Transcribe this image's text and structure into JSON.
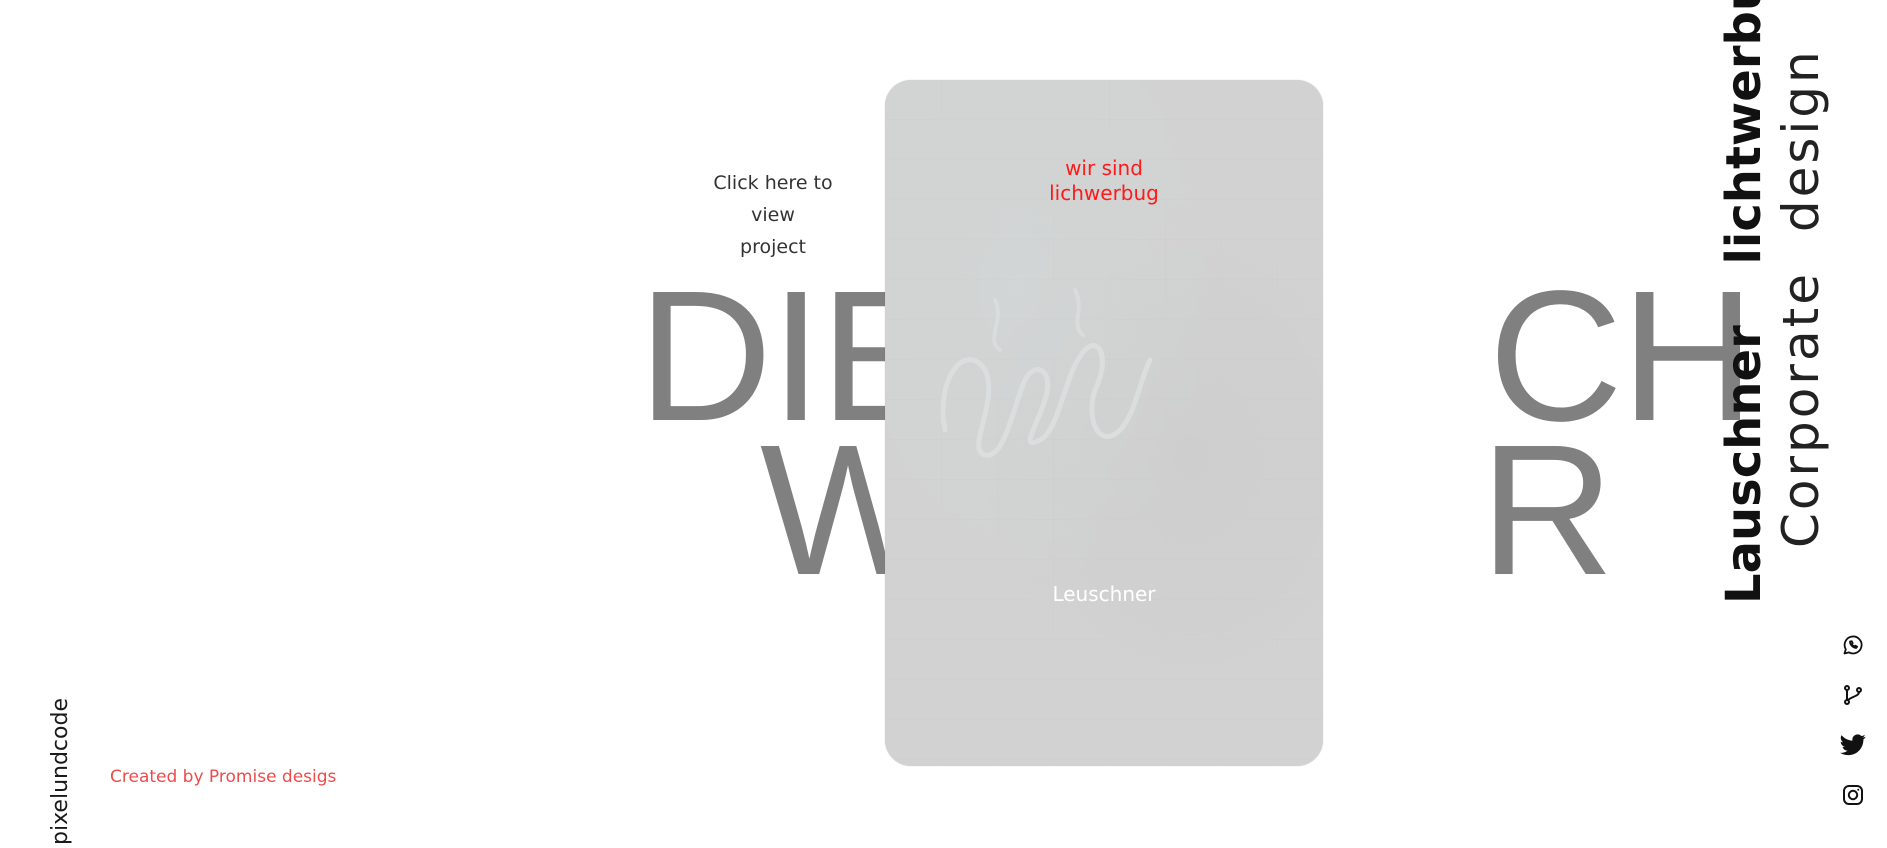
{
  "headline": {
    "line1": "DIE           CH",
    "line2": "W           R"
  },
  "card": {
    "tagline_line1": "wir sind",
    "tagline_line2": "lichwerbug",
    "name": "Leuschner",
    "tagline_color": "#ff1a1a"
  },
  "cta": {
    "line1": "Click here to view",
    "line2": "project"
  },
  "side_titles": {
    "title": "Lauschner lichtwerbung",
    "subtitle": "Corporate design"
  },
  "social": {
    "icons": [
      "whatsapp-icon",
      "git-branch-icon",
      "twitter-icon",
      "instagram-icon"
    ]
  },
  "footer": {
    "brand": "pixelundcode",
    "credit": "Created by Promise desigs",
    "credit_color": "#ef4b4b"
  },
  "colors": {
    "headline": "#808080",
    "card_background": "#d6d5d5"
  }
}
